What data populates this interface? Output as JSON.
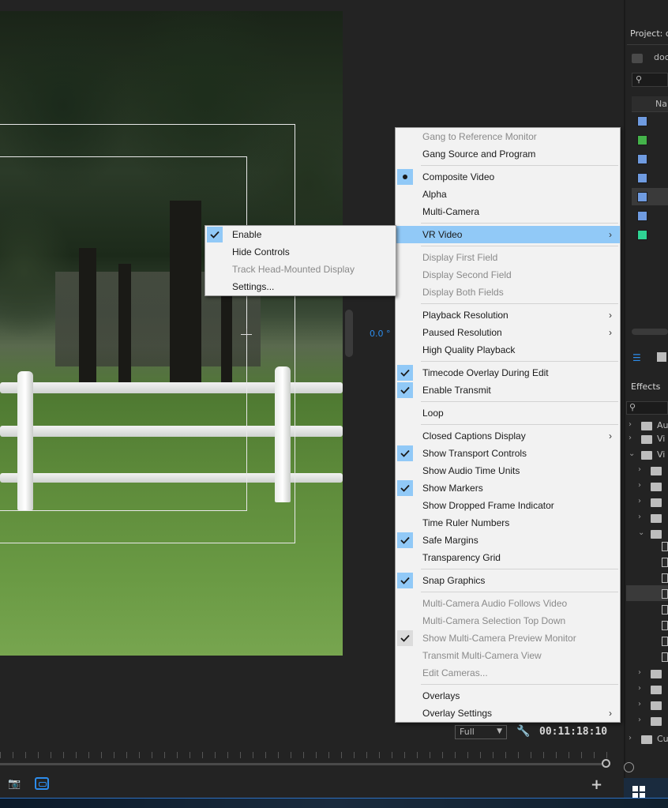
{
  "main_menu": [
    {
      "label": "Gang to Reference Monitor",
      "disabled": true
    },
    {
      "label": "Gang Source and Program"
    },
    {
      "sep": true
    },
    {
      "label": "Composite Video",
      "bullet": true
    },
    {
      "label": "Alpha"
    },
    {
      "label": "Multi-Camera"
    },
    {
      "sep": true
    },
    {
      "label": "VR Video",
      "submenu": true,
      "active": true
    },
    {
      "sep": true
    },
    {
      "label": "Display First Field",
      "disabled": true
    },
    {
      "label": "Display Second Field",
      "disabled": true
    },
    {
      "label": "Display Both Fields",
      "disabled": true
    },
    {
      "sep": true
    },
    {
      "label": "Playback Resolution",
      "submenu": true
    },
    {
      "label": "Paused Resolution",
      "submenu": true
    },
    {
      "label": "High Quality Playback"
    },
    {
      "sep": true
    },
    {
      "label": "Timecode Overlay During Edit",
      "checked": true
    },
    {
      "label": "Enable Transmit",
      "checked": true
    },
    {
      "sep": true
    },
    {
      "label": "Loop"
    },
    {
      "sep": true
    },
    {
      "label": "Closed Captions Display",
      "submenu": true
    },
    {
      "label": "Show Transport Controls",
      "checked": true
    },
    {
      "label": "Show Audio Time Units"
    },
    {
      "label": "Show Markers",
      "checked": true
    },
    {
      "label": "Show Dropped Frame Indicator"
    },
    {
      "label": "Time Ruler Numbers"
    },
    {
      "label": "Safe Margins",
      "checked": true
    },
    {
      "label": "Transparency Grid"
    },
    {
      "sep": true
    },
    {
      "label": "Snap Graphics",
      "checked": true
    },
    {
      "sep": true
    },
    {
      "label": "Multi-Camera Audio Follows Video",
      "disabled": true
    },
    {
      "label": "Multi-Camera Selection Top Down",
      "disabled": true
    },
    {
      "label": "Show Multi-Camera Preview Monitor",
      "disabled": true,
      "checked_dim": true
    },
    {
      "label": "Transmit Multi-Camera View",
      "disabled": true
    },
    {
      "label": "Edit Cameras...",
      "disabled": true
    },
    {
      "sep": true
    },
    {
      "label": "Overlays"
    },
    {
      "label": "Overlay Settings",
      "submenu": true
    }
  ],
  "vr_submenu": [
    {
      "label": "Enable",
      "checked": true
    },
    {
      "label": "Hide Controls"
    },
    {
      "label": "Track Head-Mounted Display",
      "disabled": true
    },
    {
      "label": "Settings..."
    }
  ],
  "monitor": {
    "vr_readout": "0.0 °",
    "zoom_value": "Full",
    "timecode": "00:11:18:10"
  },
  "project_panel": {
    "title": "Project: d",
    "name": "doc",
    "column_header": "Na",
    "swatch_colors": [
      "#6f9be0",
      "#44b34a",
      "#6f9be0",
      "#6f9be0",
      "#6f9be0",
      "#6f9be0",
      "#2fd494"
    ]
  },
  "effects_panel": {
    "title": "Effects",
    "tree": [
      {
        "label": "Au",
        "depth": 0,
        "open": false
      },
      {
        "label": "Vi",
        "depth": 0,
        "open": false
      },
      {
        "label": "Vi",
        "depth": 0,
        "open": true
      },
      {
        "label": "",
        "depth": 1
      },
      {
        "label": "",
        "depth": 1
      },
      {
        "label": "",
        "depth": 1
      },
      {
        "label": "",
        "depth": 1
      },
      {
        "label": "",
        "depth": 1,
        "open": true
      },
      {
        "label": "Cu",
        "depth": 0
      }
    ]
  },
  "colors": {
    "accent": "#2d8ceb",
    "menu_highlight": "#91c9f7",
    "menu_bg": "#f2f2f2",
    "panel_bg": "#232323"
  }
}
